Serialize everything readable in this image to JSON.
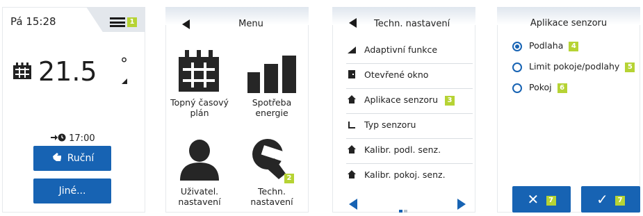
{
  "screen1": {
    "time": "Pá 15:28",
    "badge": "1",
    "temperature": "21.5",
    "degree": "°",
    "next_time": "17:00",
    "next_icon": "arrow-clock-icon",
    "buttons": {
      "manual": "Ruční",
      "other": "Jiné..."
    },
    "accent": "#1763b3"
  },
  "screen2": {
    "title": "Menu",
    "tiles": [
      {
        "label": "Topný časový plán",
        "icon": "calendar-icon"
      },
      {
        "label": "Spotřeba energie",
        "icon": "bar-chart-icon"
      },
      {
        "label": "Uživatel. nastavení",
        "icon": "user-icon"
      },
      {
        "label": "Techn. nastavení",
        "icon": "wrench-icon",
        "badge": "2"
      }
    ]
  },
  "screen3": {
    "title": "Techn. nastavení",
    "items": [
      {
        "label": "Adaptivní funkce",
        "icon": "adaptive-icon"
      },
      {
        "label": "Otevřené okno",
        "icon": "window-icon"
      },
      {
        "label": "Aplikace senzoru",
        "icon": "house-icon",
        "badge": "3"
      },
      {
        "label": "Typ senzoru",
        "icon": "sensor-type-icon"
      },
      {
        "label": "Kalibr. podl. senz.",
        "icon": "house-icon"
      },
      {
        "label": "Kalibr. pokoj. senz.",
        "icon": "house-icon"
      }
    ]
  },
  "screen4": {
    "title": "Aplikace senzoru",
    "options": [
      {
        "label": "Podlaha",
        "badge": "4",
        "selected": true
      },
      {
        "label": "Limit pokoje/podlahy",
        "badge": "5",
        "selected": false
      },
      {
        "label": "Pokoj",
        "badge": "6",
        "selected": false
      }
    ],
    "cancel_badge": "7",
    "ok_badge": "7",
    "badge_color": "#b6d334"
  }
}
